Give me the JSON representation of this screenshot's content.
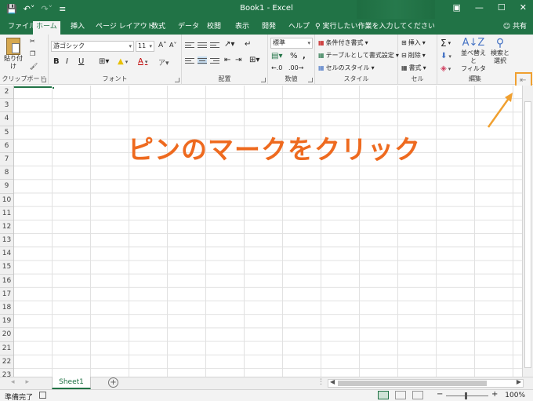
{
  "window": {
    "title": "Book1  -  Excel",
    "qat_save": "💾",
    "qat_undo": "↶˅",
    "qat_redo": "↷˅",
    "qat_more": "≡",
    "restore_icon": "▣",
    "minimize_icon": "—",
    "maximize_icon": "☐",
    "close_icon": "✕"
  },
  "tabs": [
    "ファイル",
    "ホーム",
    "挿入",
    "ページ レイアウト",
    "数式",
    "データ",
    "校閲",
    "表示",
    "開発",
    "ヘルプ"
  ],
  "tell_me": "実行したい作業を入力してください",
  "share": "共有",
  "ribbon": {
    "paste_label": "貼り付け",
    "clipboard_label": "クリップボード",
    "font_name": "游ゴシック",
    "font_size": "11",
    "font_label": "フォント",
    "bold": "B",
    "italic": "I",
    "underline": "U",
    "grow": "A˄",
    "shrink": "A˅",
    "align_label": "配置",
    "number_format": "標準",
    "percent": "%",
    "comma": ",",
    "number_label": "数値",
    "cond_format": "条件付き書式",
    "format_table": "テーブルとして書式設定",
    "cell_styles": "セルのスタイル",
    "styles_label": "スタイル",
    "insert": "挿入",
    "delete": "削除",
    "format": "書式",
    "cells_label": "セル",
    "sum": "Σ",
    "sort_filter": "並べ替えと\nフィルター",
    "find_select": "検索と\n選択",
    "editing_label": "編集",
    "pin_icon": "⇤"
  },
  "rows": [
    "2",
    "3",
    "4",
    "5",
    "6",
    "7",
    "8",
    "9",
    "10",
    "11",
    "12",
    "13",
    "14",
    "15",
    "16",
    "17",
    "18",
    "19",
    "20",
    "21",
    "22",
    "23"
  ],
  "annotation": {
    "text": "ピンのマークをクリック",
    "color": "#ee6a1f",
    "highlight_color": "#f0a030"
  },
  "sheets": {
    "nav_prev": "◂",
    "nav_next": "▸",
    "active": "Sheet1",
    "add": "+",
    "dots": "⋮"
  },
  "status": {
    "ready": "準備完了",
    "zoom": "100%",
    "zoom_minus": "−",
    "zoom_plus": "+"
  },
  "colors": {
    "accent": "#217346",
    "ribbon_bg": "#f3f3f3"
  }
}
